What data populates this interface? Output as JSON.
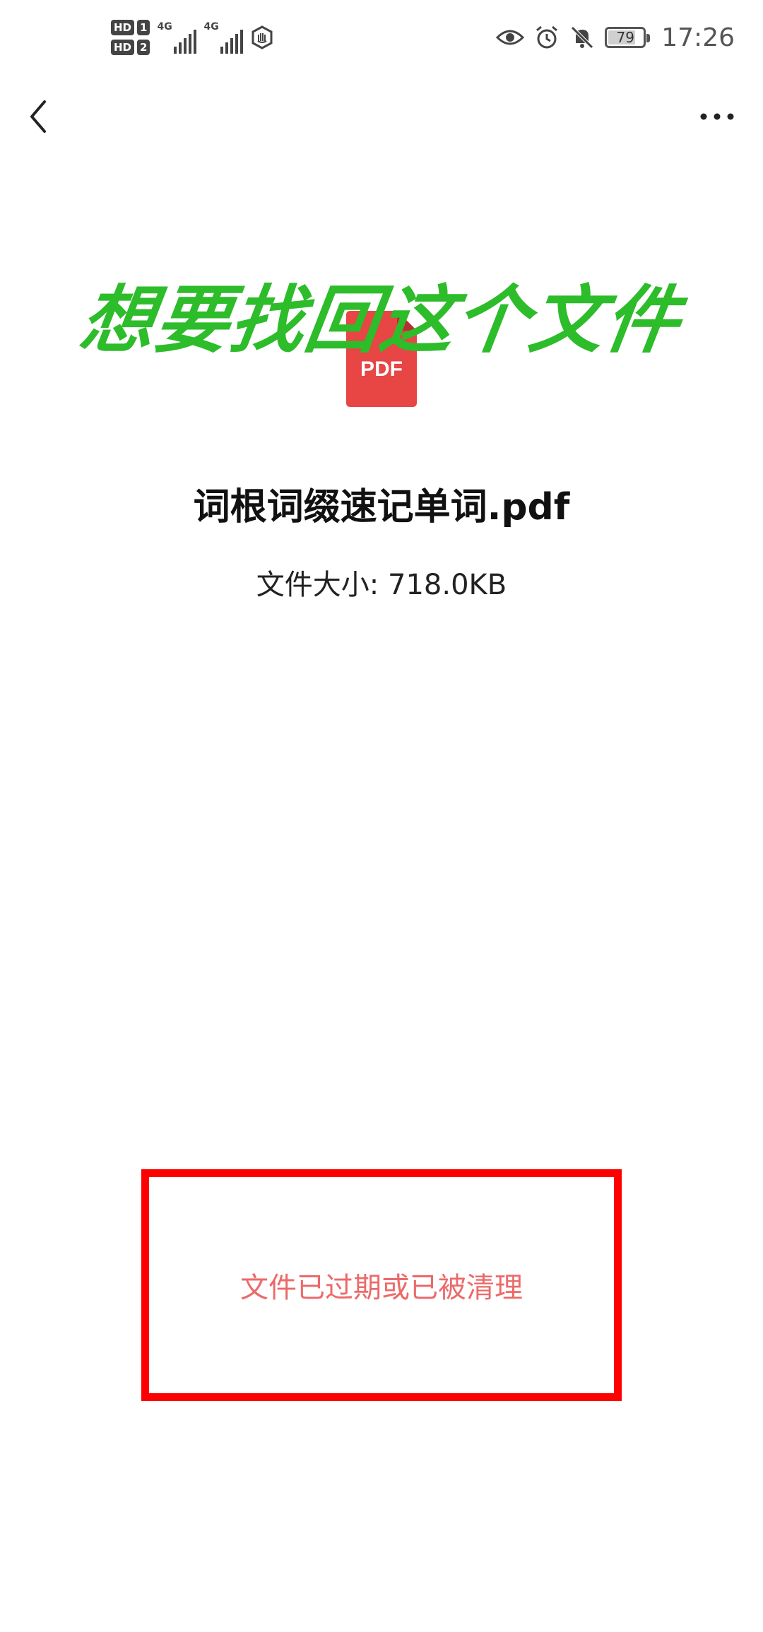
{
  "status_bar": {
    "hd_badges": [
      {
        "label": "HD",
        "sim": "1"
      },
      {
        "label": "HD",
        "sim": "2"
      }
    ],
    "networks": [
      "4G",
      "4G"
    ],
    "signal_levels": [
      4,
      4
    ],
    "battery_percent": "79",
    "battery_level": 0.79,
    "time": "17:26",
    "icons": [
      "eye-icon",
      "alarm-icon",
      "bell-muted-icon"
    ]
  },
  "nav": {
    "back_icon": "chevron-left-icon",
    "more_icon": "more-dots-icon"
  },
  "headline": "想要找回这个文件",
  "file": {
    "type_label": "PDF",
    "icon_color": "#e84545",
    "name": "词根词缀速记单词.pdf",
    "size_label": "文件大小:",
    "size_value": "718.0KB"
  },
  "status": {
    "message": "文件已过期或已被清理",
    "border_color": "#ff0000",
    "text_color": "#ec6a6a"
  }
}
